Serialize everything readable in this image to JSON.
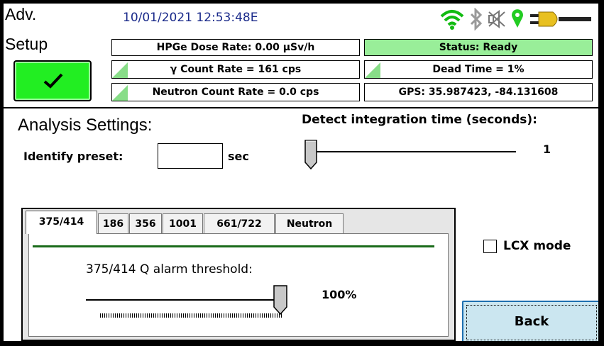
{
  "header": {
    "title_line1": "Adv.",
    "title_line2": "Setup",
    "datetime": "10/01/2021 12:53:48E"
  },
  "status_icons": [
    "wifi-icon",
    "bluetooth-icon",
    "speaker-muted-icon",
    "location-pin-icon",
    "power-plug-icon"
  ],
  "readouts": {
    "hpge_dose_rate": "HPGe Dose Rate: 0.00  μSv/h",
    "status": "Status: Ready",
    "gamma_count_rate": "γ Count Rate = 161 cps",
    "dead_time": "Dead Time = 1%",
    "neutron_count_rate": "Neutron Count Rate = 0.0 cps",
    "gps": "GPS: 35.987423, -84.131608"
  },
  "confirm_button": {
    "icon": "checkmark-icon"
  },
  "analysis": {
    "heading": "Analysis Settings:",
    "identify_preset_label": "Identify preset:",
    "identify_preset_value": "",
    "identify_preset_unit": "sec",
    "integration_label": "Detect integration time (seconds):",
    "integration_value": "1",
    "integration_slider_fraction": 0.0
  },
  "tabs": {
    "items": [
      {
        "label": "375/414",
        "active": true
      },
      {
        "label": "186",
        "active": false
      },
      {
        "label": "356",
        "active": false
      },
      {
        "label": "1001",
        "active": false
      },
      {
        "label": "661/722",
        "active": false
      },
      {
        "label": "Neutron",
        "active": false
      }
    ],
    "threshold_label": "375/414 Q alarm threshold:",
    "threshold_value": "100%",
    "threshold_fraction": 1.0
  },
  "lcx_mode": {
    "label": "LCX mode",
    "checked": false
  },
  "back_button": {
    "label": "Back"
  },
  "colors": {
    "accent_green": "#22ee22",
    "status_green": "#99ee99",
    "datetime_blue": "#1a2a8a",
    "tab_line": "#1a6b1a",
    "back_blue": "#cbe6f0"
  }
}
